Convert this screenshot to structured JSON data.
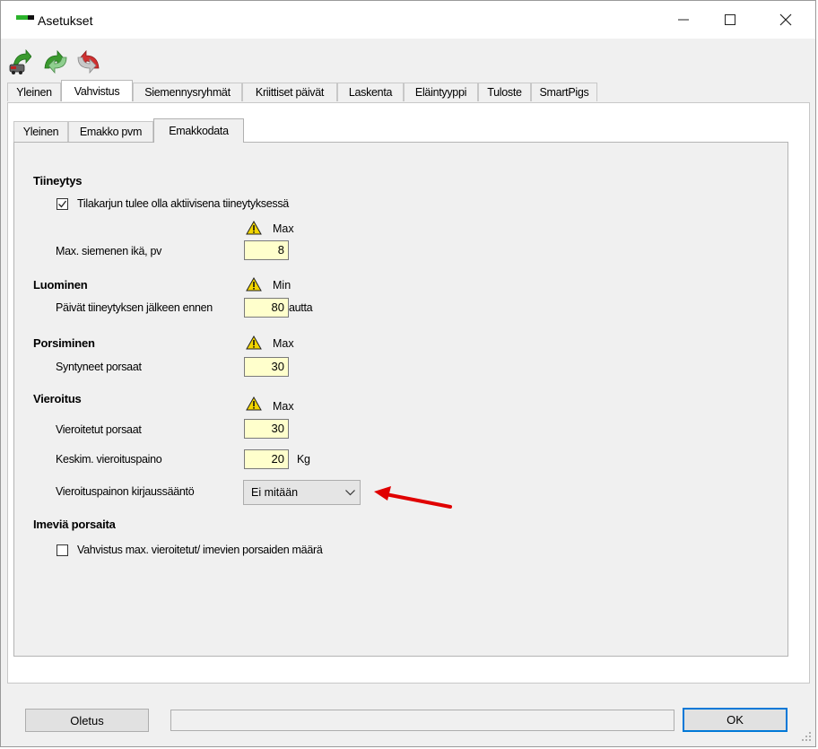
{
  "window": {
    "title": "Asetukset"
  },
  "toolbar": {
    "icons": [
      "save-icon",
      "refresh-icon",
      "undo-icon"
    ]
  },
  "tabs": [
    "Yleinen",
    "Vahvistus",
    "Siemennysryhmät",
    "Kriittiset päivät",
    "Laskenta",
    "Eläintyyppi",
    "Tuloste",
    "SmartPigs"
  ],
  "active_tab": "Vahvistus",
  "subtabs": [
    "Yleinen",
    "Emakko pvm",
    "Emakkodata"
  ],
  "active_subtab": "Emakkodata",
  "tiineytys": {
    "heading": "Tiineytys",
    "checkbox_label": "Tilakarjun tulee olla aktiivisena tiineytyksessä",
    "checkbox_checked": true,
    "limit_label": "Max",
    "max_age_label": "Max. siemenen ikä, pv",
    "max_age_value": "8"
  },
  "luominen": {
    "heading": "Luominen",
    "limit_label": "Min",
    "days_label": "Päivät tiineytyksen jälkeen ennen",
    "days_value": "80",
    "days_suffix": "autta"
  },
  "porsiminen": {
    "heading": "Porsiminen",
    "limit_label": "Max",
    "born_label": "Syntyneet porsaat",
    "born_value": "30"
  },
  "vieroitus": {
    "heading": "Vieroitus",
    "limit_label": "Max",
    "weaned_label": "Vieroitetut porsaat",
    "weaned_value": "30",
    "weight_label": "Keskim. vieroituspaino",
    "weight_value": "20",
    "weight_unit": "Kg",
    "rule_label": "Vieroituspainon kirjaussääntö",
    "rule_value": "Ei mitään"
  },
  "imevia": {
    "heading": "Imeviä porsaita",
    "checkbox_label": "Vahvistus max. vieroitetut/ imevien porsaiden määrä",
    "checkbox_checked": false
  },
  "footer": {
    "default_button": "Oletus",
    "ok_button": "OK"
  },
  "colors": {
    "field_bg": "#ffffcc",
    "arrow": "#e00000",
    "warning": "#f2d500"
  }
}
